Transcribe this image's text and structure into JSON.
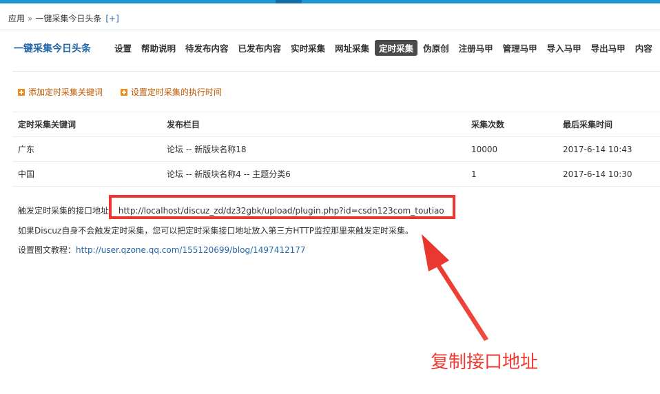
{
  "breadcrumb": {
    "root": "应用",
    "separator": "»",
    "current": "一键采集今日头条",
    "plus": "[+]"
  },
  "app": {
    "title": "一键采集今日头条"
  },
  "nav": {
    "items": [
      "设置",
      "帮助说明",
      "待发布内容",
      "已发布内容",
      "实时采集",
      "网址采集",
      "定时采集",
      "伪原创",
      "注册马甲",
      "管理马甲",
      "导入马甲",
      "导出马甲",
      "内容"
    ],
    "active": "定时采集"
  },
  "actions": {
    "add_keyword": "添加定时采集关键词",
    "set_time": "设置定时采集的执行时间"
  },
  "table": {
    "headers": [
      "定时采集关键词",
      "发布栏目",
      "采集次数",
      "最后采集时间"
    ],
    "rows": [
      [
        "广东",
        "论坛 -- 新版块名称18",
        "10000",
        "2017-6-14 10:43"
      ],
      [
        "中国",
        "论坛 -- 新版块名称4 -- 主题分类6",
        "1",
        "2017-6-14 10:30"
      ]
    ]
  },
  "info": {
    "endpoint_label": "触发定时采集的接口地址",
    "endpoint_url": "http://localhost/discuz_zd/dz32gbk/upload/plugin.php?id=csdn123com_toutiao",
    "note": "如果Discuz自身不会触发定时采集，您可以把定时采集接口地址放入第三方HTTP监控那里来触发定时采集。",
    "tutorial_label": "设置图文教程：",
    "tutorial_url": "http://user.qzone.qq.com/155120699/blog/1497412177"
  },
  "annotation": {
    "text": "复制接口地址",
    "color": "#ee3a32"
  },
  "colors": {
    "accent": "#2366a8",
    "topbar": "#1e95d3",
    "action": "#c05a00",
    "active_tab": "#4a4a4a"
  }
}
